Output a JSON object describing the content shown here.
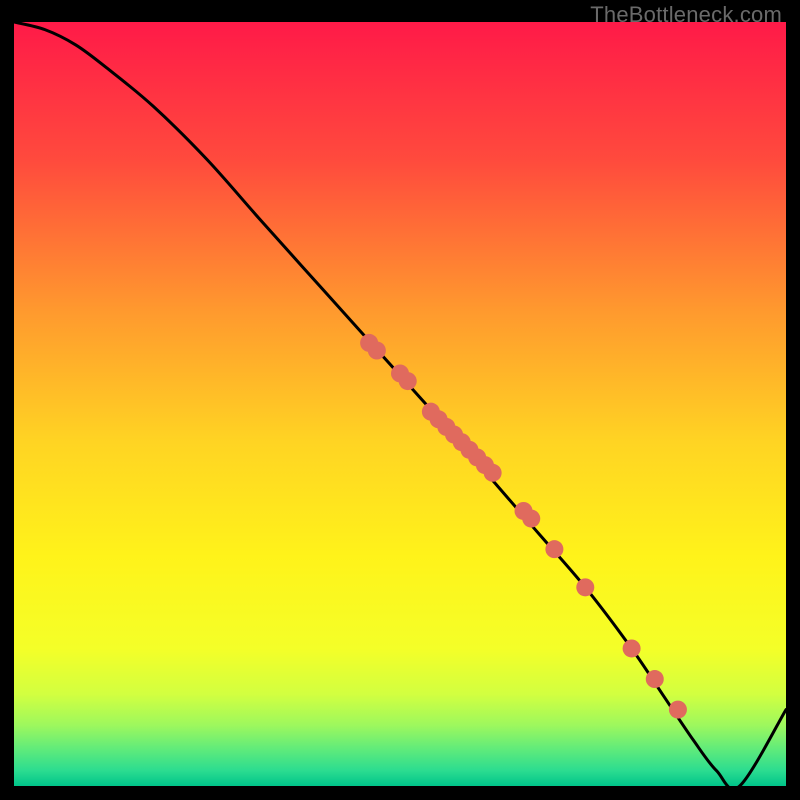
{
  "watermark": "TheBottleneck.com",
  "colors": {
    "gradient_top": "#ff1a48",
    "gradient_mid_upper": "#ff7a3a",
    "gradient_mid": "#ffd423",
    "gradient_mid_lower": "#f7ff2a",
    "gradient_green1": "#cfff4a",
    "gradient_green2": "#7cf573",
    "gradient_green3": "#23db92",
    "gradient_bottom": "#00c48a",
    "curve": "#000000",
    "marker": "#e06a5e",
    "frame": "#000000"
  },
  "chart_data": {
    "type": "line",
    "title": "",
    "xlabel": "",
    "ylabel": "",
    "xlim": [
      0,
      100
    ],
    "ylim": [
      0,
      100
    ],
    "series": [
      {
        "name": "bottleneck-curve",
        "x": [
          0,
          4,
          8,
          12,
          18,
          25,
          32,
          40,
          48,
          56,
          62,
          68,
          74,
          80,
          84,
          88,
          91,
          94,
          100
        ],
        "y": [
          100,
          99,
          97,
          94,
          89,
          82,
          74,
          65,
          56,
          47,
          40,
          33,
          26,
          18,
          12,
          6,
          2,
          0,
          10
        ]
      }
    ],
    "markers": {
      "name": "highlight-points",
      "x": [
        46,
        47,
        50,
        51,
        54,
        55,
        56,
        57,
        58,
        59,
        60,
        61,
        62,
        66,
        67,
        70,
        74,
        80,
        83,
        86
      ],
      "y": [
        58,
        57,
        54,
        53,
        49,
        48,
        47,
        46,
        45,
        44,
        43,
        42,
        41,
        36,
        35,
        31,
        26,
        18,
        14,
        10
      ]
    }
  }
}
